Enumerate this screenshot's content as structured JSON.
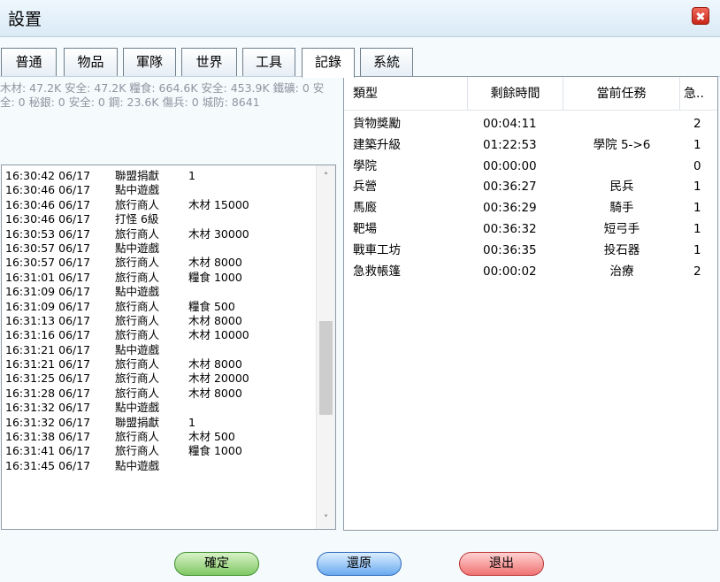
{
  "window": {
    "title": "設置"
  },
  "tabs": [
    {
      "label": "普通",
      "active": false
    },
    {
      "label": "物品",
      "active": false
    },
    {
      "label": "軍隊",
      "active": false
    },
    {
      "label": "世界",
      "active": false
    },
    {
      "label": "工具",
      "active": false
    },
    {
      "label": "記錄",
      "active": true
    },
    {
      "label": "系統",
      "active": false
    }
  ],
  "resources": {
    "text": "木材: 47.2K 安全: 47.2K 糧食: 664.6K 安全: 453.9K 鐵礦: 0 安全: 0 秘銀: 0 安全: 0 鋼: 23.6K 傷兵: 0 城防: 8641"
  },
  "log": {
    "rows": [
      {
        "time": "16:30:42 06/17",
        "type": "聯盟捐獻",
        "detail": "1"
      },
      {
        "time": "16:30:46 06/17",
        "type": "點中遊戲",
        "detail": ""
      },
      {
        "time": "16:30:46 06/17",
        "type": "旅行商人",
        "detail": "木材 15000"
      },
      {
        "time": "16:30:46 06/17",
        "type": "打怪  6級",
        "detail": ""
      },
      {
        "time": "16:30:53 06/17",
        "type": "旅行商人",
        "detail": "木材 30000"
      },
      {
        "time": "16:30:57 06/17",
        "type": "點中遊戲",
        "detail": ""
      },
      {
        "time": "16:30:57 06/17",
        "type": "旅行商人",
        "detail": "木材 8000"
      },
      {
        "time": "16:31:01 06/17",
        "type": "旅行商人",
        "detail": "糧食 1000"
      },
      {
        "time": "16:31:09 06/17",
        "type": "點中遊戲",
        "detail": ""
      },
      {
        "time": "16:31:09 06/17",
        "type": "旅行商人",
        "detail": "糧食 500"
      },
      {
        "time": "16:31:13 06/17",
        "type": "旅行商人",
        "detail": "木材 8000"
      },
      {
        "time": "16:31:16 06/17",
        "type": "旅行商人",
        "detail": "木材 10000"
      },
      {
        "time": "16:31:21 06/17",
        "type": "點中遊戲",
        "detail": ""
      },
      {
        "time": "16:31:21 06/17",
        "type": "旅行商人",
        "detail": "木材 8000"
      },
      {
        "time": "16:31:25 06/17",
        "type": "旅行商人",
        "detail": "木材 20000"
      },
      {
        "time": "16:31:28 06/17",
        "type": "旅行商人",
        "detail": "木材 8000"
      },
      {
        "time": "16:31:32 06/17",
        "type": "點中遊戲",
        "detail": ""
      },
      {
        "time": "16:31:32 06/17",
        "type": "聯盟捐獻",
        "detail": "1"
      },
      {
        "time": "16:31:38 06/17",
        "type": "旅行商人",
        "detail": "木材 500"
      },
      {
        "time": "16:31:41 06/17",
        "type": "旅行商人",
        "detail": "糧食 1000"
      },
      {
        "time": "16:31:45 06/17",
        "type": "點中遊戲",
        "detail": ""
      }
    ]
  },
  "tasks": {
    "columns": [
      "類型",
      "剩餘時間",
      "當前任務",
      "急.."
    ],
    "rows": [
      {
        "type": "貨物獎勵",
        "time": "00:04:11",
        "task": "",
        "count": "2"
      },
      {
        "type": "建築升級",
        "time": "01:22:53",
        "task": "學院 5->6",
        "count": "1"
      },
      {
        "type": "學院",
        "time": "00:00:00",
        "task": "",
        "count": "0"
      },
      {
        "type": "兵營",
        "time": "00:36:27",
        "task": "民兵",
        "count": "1"
      },
      {
        "type": "馬廄",
        "time": "00:36:29",
        "task": "騎手",
        "count": "1"
      },
      {
        "type": "靶場",
        "time": "00:36:32",
        "task": "短弓手",
        "count": "1"
      },
      {
        "type": "戰車工坊",
        "time": "00:36:35",
        "task": "投石器",
        "count": "1"
      },
      {
        "type": "急救帳篷",
        "time": "00:00:02",
        "task": "治療",
        "count": "2"
      }
    ]
  },
  "buttons": {
    "ok": "確定",
    "reset": "還原",
    "exit": "退出"
  },
  "colors": {
    "ok": "#7fc864",
    "reset": "#6aaaf0",
    "exit": "#f07272",
    "close": "#c8261a"
  },
  "icons": {
    "close": "close-icon",
    "scroll_up": "chevron-up-icon",
    "scroll_down": "chevron-down-icon"
  }
}
